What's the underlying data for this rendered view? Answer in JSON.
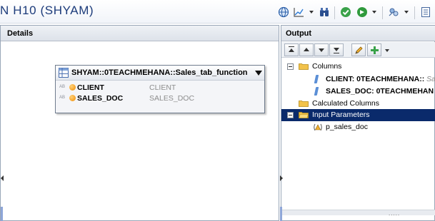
{
  "header": {
    "title": "N H10 (SHYAM)"
  },
  "toolbar": {
    "icons": [
      "globe-icon",
      "chart-icon",
      "binoculars-icon",
      "check-icon",
      "run-icon",
      "debug-icon",
      "panel-icon"
    ]
  },
  "details": {
    "title": "Details",
    "table": {
      "title": "SHYAM::0TEACHMEHANA::Sales_tab_function",
      "columns": [
        {
          "type_tag": "AB",
          "name": "CLIENT",
          "alias": "CLIENT"
        },
        {
          "type_tag": "AB",
          "name": "SALES_DOC",
          "alias": "SALES_DOC"
        }
      ]
    }
  },
  "output": {
    "title": "Output",
    "tree": {
      "columns_label": "Columns",
      "columns": [
        "CLIENT: 0TEACHMEHANA::",
        "SALES_DOC: 0TEACHMEHAN"
      ],
      "columns_suffix": "Sa",
      "calculated_label": "Calculated Columns",
      "input_params_label": "Input Parameters",
      "param": "p_sales_doc"
    }
  },
  "colors": {
    "title": "#1c3b7a",
    "selection": "#0a2a6b",
    "folder": "#f2c24a"
  }
}
